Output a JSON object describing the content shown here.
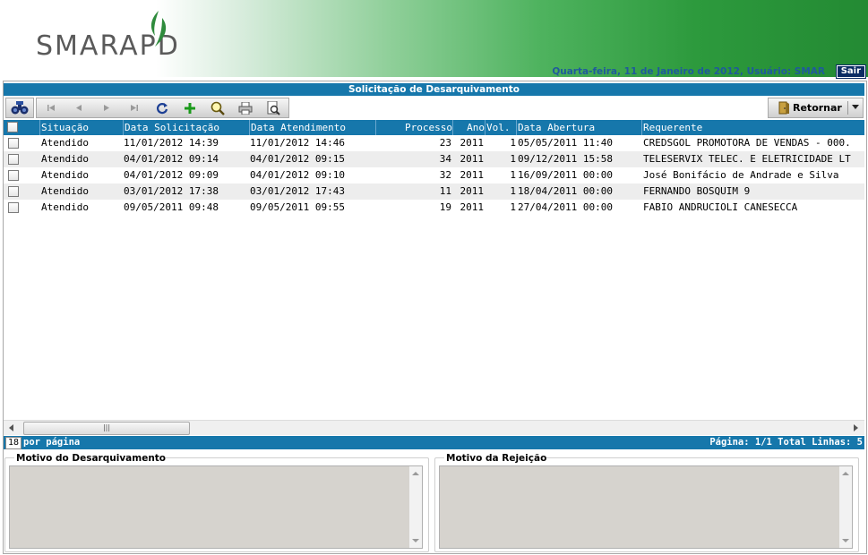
{
  "header": {
    "logo_text": "SMARAPD",
    "status_line": "Quarta-feira, 11 de Janeiro de 2012, Usuário: SMAR",
    "logout_label": "Sair"
  },
  "page": {
    "title": "Solicitação de Desarquivamento"
  },
  "toolbar": {
    "search_icon": "binoculars-icon",
    "nav_icons": [
      "first-page-icon",
      "prev-page-icon",
      "next-page-icon",
      "last-page-icon",
      "refresh-icon",
      "add-icon",
      "search-icon",
      "print-icon",
      "print-preview-icon"
    ],
    "retornar_label": "Retornar"
  },
  "grid": {
    "columns": {
      "situacao": "Situação",
      "data_solicitacao": "Data Solicitação",
      "data_atendimento": "Data Atendimento",
      "processo": "Processo",
      "ano": "Ano",
      "vol": "Vol.",
      "data_abertura": "Data Abertura",
      "requerente": "Requerente"
    },
    "rows": [
      {
        "situacao": "Atendido",
        "data_solicitacao": "11/01/2012 14:39",
        "data_atendimento": "11/01/2012 14:46",
        "processo": "23",
        "ano": "2011",
        "vol": "1",
        "data_abertura": "05/05/2011 11:40",
        "requerente": "CREDSGOL PROMOTORA DE VENDAS - 000."
      },
      {
        "situacao": "Atendido",
        "data_solicitacao": "04/01/2012 09:14",
        "data_atendimento": "04/01/2012 09:15",
        "processo": "34",
        "ano": "2011",
        "vol": "1",
        "data_abertura": "09/12/2011 15:58",
        "requerente": "TELESERVIX TELEC. E ELETRICIDADE LT"
      },
      {
        "situacao": "Atendido",
        "data_solicitacao": "04/01/2012 09:09",
        "data_atendimento": "04/01/2012 09:10",
        "processo": "32",
        "ano": "2011",
        "vol": "1",
        "data_abertura": "16/09/2011 00:00",
        "requerente": "José Bonifácio de Andrade e Silva"
      },
      {
        "situacao": "Atendido",
        "data_solicitacao": "03/01/2012 17:38",
        "data_atendimento": "03/01/2012 17:43",
        "processo": "11",
        "ano": "2011",
        "vol": "1",
        "data_abertura": "18/04/2011 00:00",
        "requerente": "FERNANDO BOSQUIM 9"
      },
      {
        "situacao": "Atendido",
        "data_solicitacao": "09/05/2011 09:48",
        "data_atendimento": "09/05/2011 09:55",
        "processo": "19",
        "ano": "2011",
        "vol": "1",
        "data_abertura": "27/04/2011 00:00",
        "requerente": "FABIO ANDRUCIOLI CANESECCA"
      }
    ]
  },
  "pager": {
    "per_page_value": "18",
    "per_page_label": "por página",
    "summary": "Página: 1/1 Total Linhas: 5"
  },
  "panels": {
    "motivo_desarquivamento": "Motivo do Desarquivamento",
    "motivo_rejeicao": "Motivo da Rejeição"
  },
  "colors": {
    "accent_blue": "#1677ab",
    "header_green": "#238a33",
    "logout_bg": "#0b2c63"
  }
}
